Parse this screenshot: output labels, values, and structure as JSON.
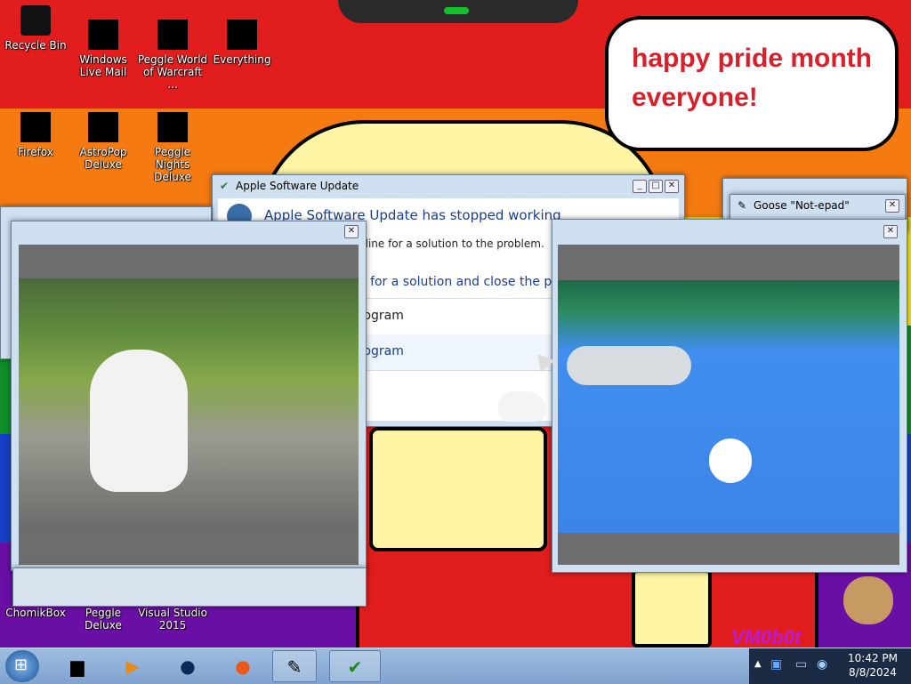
{
  "wallpaper": {
    "speech_bubble": "happy pride month everyone!",
    "watermark": "VM0b0t",
    "colors": {
      "red": "#e11d1d",
      "orange": "#f57a12",
      "yellow": "#f7e81b",
      "green": "#0f8f2a",
      "blue": "#1740c9",
      "purple": "#6a0fa5",
      "face": "#fff6a5"
    }
  },
  "desktop_icons": [
    {
      "label": "Recycle Bin",
      "icon": "recycle-bin-icon"
    },
    {
      "label": "Windows Live Mail",
      "icon": "mail-icon"
    },
    {
      "label": "Peggle World of Warcraft ...",
      "icon": "peggle-icon"
    },
    {
      "label": "Everything",
      "icon": "search-icon"
    },
    {
      "label": "Firefox",
      "icon": "firefox-icon"
    },
    {
      "label": "AstroPop Deluxe",
      "icon": "astropop-icon"
    },
    {
      "label": "Peggle Nights Deluxe",
      "icon": "peggle-nights-icon"
    },
    {
      "label": "ChomikBox",
      "icon": "chomikbox-icon"
    },
    {
      "label": "Peggle Deluxe",
      "icon": "peggle-deluxe-icon"
    },
    {
      "label": "Visual Studio 2015",
      "icon": "visual-studio-icon"
    }
  ],
  "apple_update": {
    "title": "Apple Software Update",
    "heading": "Apple Software Update has stopped working",
    "line1": "nline for a solution to the problem.",
    "option1": "e for a solution and close the p",
    "option2": "rogram",
    "option3": "rogram"
  },
  "goose_notepad": {
    "title": "Goose \"Not-epad\""
  },
  "close_glyph": "✕",
  "taskbar": {
    "time": "10:42 PM",
    "date": "8/8/2024"
  }
}
